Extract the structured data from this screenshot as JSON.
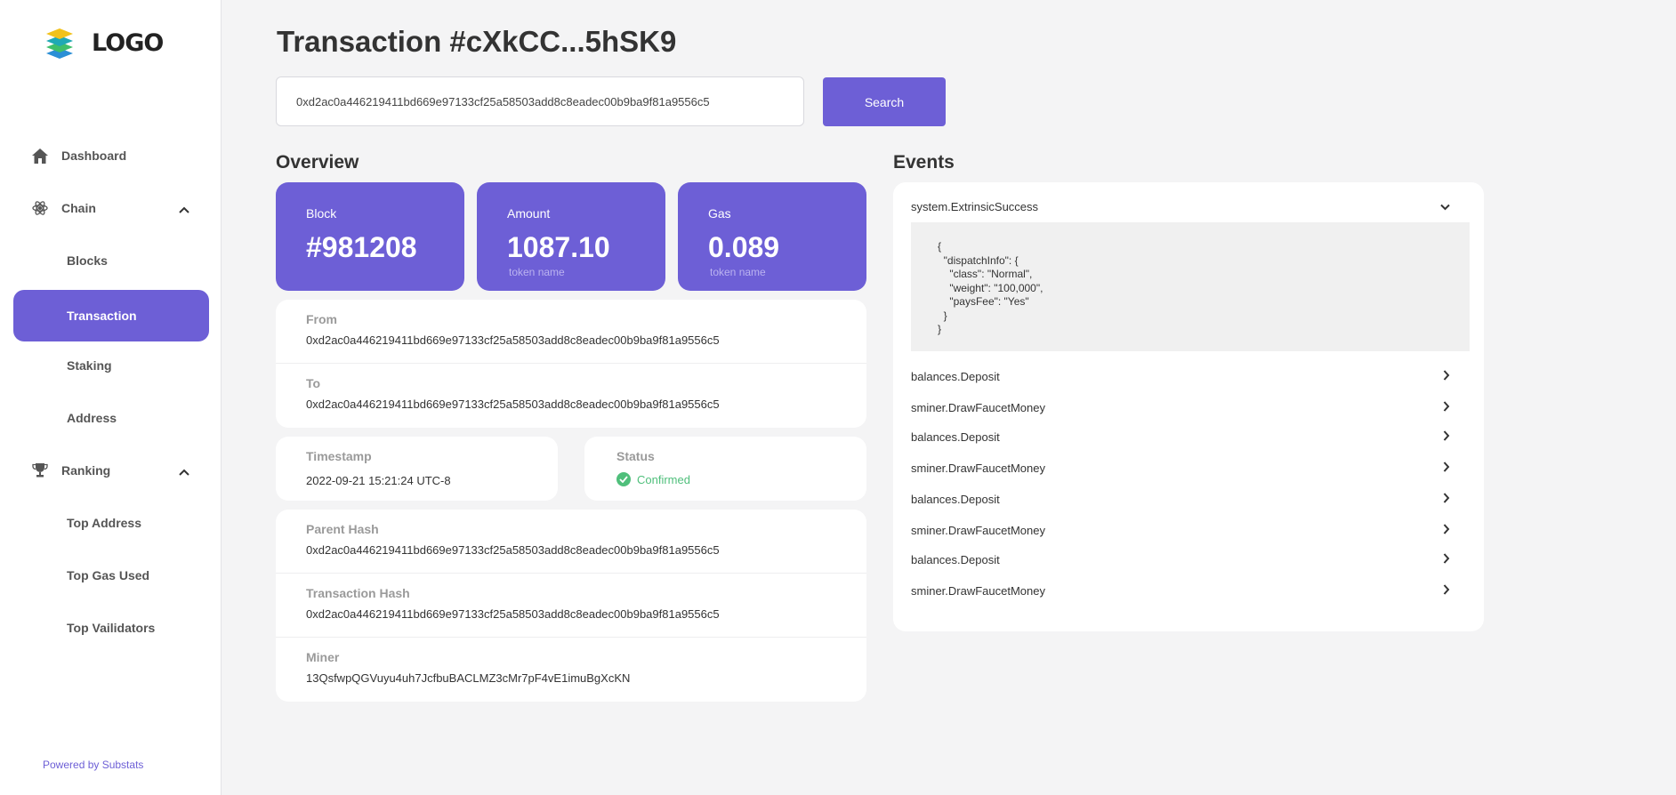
{
  "logo_text": "LOGO",
  "nav": {
    "dashboard": "Dashboard",
    "chain": "Chain",
    "blocks": "Blocks",
    "transaction": "Transaction",
    "staking": "Staking",
    "address": "Address",
    "ranking": "Ranking",
    "top_address": "Top Address",
    "top_gas_used": "Top Gas Used",
    "top_validators": "Top Vailidators"
  },
  "powered_by": "Powered by Substats",
  "page_title": "Transaction #cXkCC...5hSK9",
  "search": {
    "value": "0xd2ac0a446219411bd669e97133cf25a58503add8c8eadec00b9ba9f81a9556c5",
    "button": "Search"
  },
  "overview": {
    "title": "Overview",
    "block_label": "Block",
    "block_value": "#981208",
    "amount_label": "Amount",
    "amount_value": "1087.10",
    "amount_unit": "token name",
    "gas_label": "Gas",
    "gas_value": "0.089",
    "gas_unit": "token name",
    "from_label": "From",
    "from_value": "0xd2ac0a446219411bd669e97133cf25a58503add8c8eadec00b9ba9f81a9556c5",
    "to_label": "To",
    "to_value": "0xd2ac0a446219411bd669e97133cf25a58503add8c8eadec00b9ba9f81a9556c5",
    "timestamp_label": "Timestamp",
    "timestamp_value": "2022-09-21 15:21:24 UTC-8",
    "status_label": "Status",
    "status_value": "Confirmed",
    "parent_hash_label": "Parent Hash",
    "parent_hash_value": "0xd2ac0a446219411bd669e97133cf25a58503add8c8eadec00b9ba9f81a9556c5",
    "tx_hash_label": "Transaction Hash",
    "tx_hash_value": "0xd2ac0a446219411bd669e97133cf25a58503add8c8eadec00b9ba9f81a9556c5",
    "miner_label": "Miner",
    "miner_value": "13QsfwpQGVuyu4uh7JcfbuBACLMZ3cMr7pF4vE1imuBgXcKN"
  },
  "events": {
    "title": "Events",
    "expanded": "system.ExtrinsicSuccess",
    "code": "{\n  \"dispatchInfo\": {\n    \"class\": \"Normal\",\n    \"weight\": \"100,000\",\n    \"paysFee\": \"Yes\"\n  }\n}",
    "items": [
      "balances.Deposit",
      "sminer.DrawFaucetMoney",
      "balances.Deposit",
      "sminer.DrawFaucetMoney",
      "balances.Deposit",
      "sminer.DrawFaucetMoney",
      "balances.Deposit",
      "sminer.DrawFaucetMoney"
    ]
  },
  "colors": {
    "accent": "#6d5fd6",
    "success": "#4fbf7b"
  },
  "icons": [
    "home-icon",
    "atom-icon",
    "trophy-icon",
    "chevron-up-icon",
    "chevron-down-icon",
    "chevron-right-icon",
    "check-circle-icon",
    "layers-logo-icon"
  ]
}
